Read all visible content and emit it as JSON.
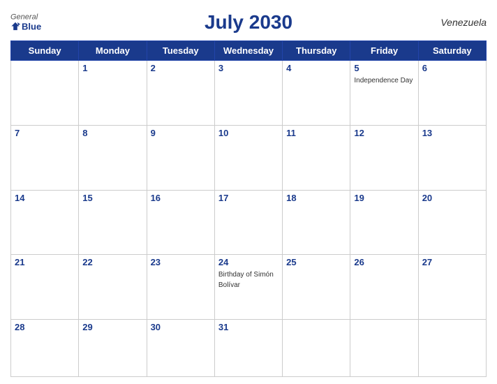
{
  "header": {
    "title": "July 2030",
    "country": "Venezuela",
    "logo": {
      "general": "General",
      "blue": "Blue"
    }
  },
  "days_of_week": [
    "Sunday",
    "Monday",
    "Tuesday",
    "Wednesday",
    "Thursday",
    "Friday",
    "Saturday"
  ],
  "weeks": [
    [
      {
        "day": "",
        "holiday": ""
      },
      {
        "day": "1",
        "holiday": ""
      },
      {
        "day": "2",
        "holiday": ""
      },
      {
        "day": "3",
        "holiday": ""
      },
      {
        "day": "4",
        "holiday": ""
      },
      {
        "day": "5",
        "holiday": "Independence Day"
      },
      {
        "day": "6",
        "holiday": ""
      }
    ],
    [
      {
        "day": "7",
        "holiday": ""
      },
      {
        "day": "8",
        "holiday": ""
      },
      {
        "day": "9",
        "holiday": ""
      },
      {
        "day": "10",
        "holiday": ""
      },
      {
        "day": "11",
        "holiday": ""
      },
      {
        "day": "12",
        "holiday": ""
      },
      {
        "day": "13",
        "holiday": ""
      }
    ],
    [
      {
        "day": "14",
        "holiday": ""
      },
      {
        "day": "15",
        "holiday": ""
      },
      {
        "day": "16",
        "holiday": ""
      },
      {
        "day": "17",
        "holiday": ""
      },
      {
        "day": "18",
        "holiday": ""
      },
      {
        "day": "19",
        "holiday": ""
      },
      {
        "day": "20",
        "holiday": ""
      }
    ],
    [
      {
        "day": "21",
        "holiday": ""
      },
      {
        "day": "22",
        "holiday": ""
      },
      {
        "day": "23",
        "holiday": ""
      },
      {
        "day": "24",
        "holiday": "Birthday of Simón Bolívar"
      },
      {
        "day": "25",
        "holiday": ""
      },
      {
        "day": "26",
        "holiday": ""
      },
      {
        "day": "27",
        "holiday": ""
      }
    ],
    [
      {
        "day": "28",
        "holiday": ""
      },
      {
        "day": "29",
        "holiday": ""
      },
      {
        "day": "30",
        "holiday": ""
      },
      {
        "day": "31",
        "holiday": ""
      },
      {
        "day": "",
        "holiday": ""
      },
      {
        "day": "",
        "holiday": ""
      },
      {
        "day": "",
        "holiday": ""
      }
    ]
  ]
}
